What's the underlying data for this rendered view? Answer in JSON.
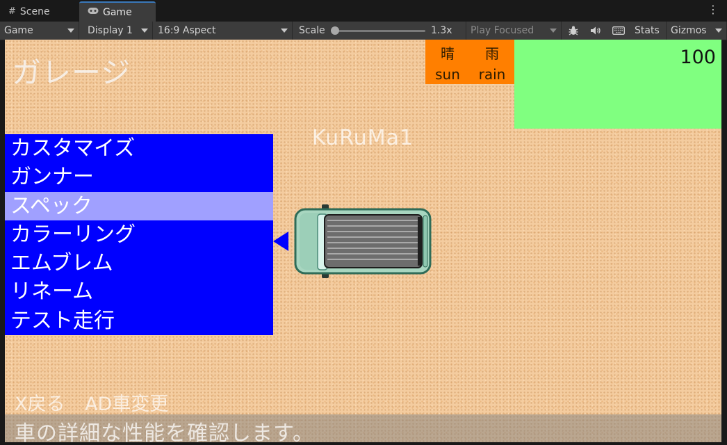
{
  "editor": {
    "tabs": [
      {
        "label": "Scene",
        "icon": "hash-icon",
        "active": false
      },
      {
        "label": "Game",
        "icon": "gamepad-icon",
        "active": true
      }
    ],
    "toolbar": {
      "view_mode": "Game",
      "display": "Display 1",
      "aspect": "16:9 Aspect",
      "scale_label": "Scale",
      "scale_value": "1.3x",
      "play_mode": "Play Focused",
      "stats_label": "Stats",
      "gizmos_label": "Gizmos"
    }
  },
  "game": {
    "title": "ガレージ",
    "weather": {
      "sun_kanji": "晴",
      "rain_kanji": "雨",
      "sun_label": "sun",
      "rain_label": "rain",
      "color": "#ff7f00"
    },
    "score": "100",
    "car_name": "KuRuMa1",
    "menu": {
      "items": [
        {
          "label": "カスタマイズ"
        },
        {
          "label": "ガンナー"
        },
        {
          "label": "スペック"
        },
        {
          "label": "カラーリング"
        },
        {
          "label": "エムブレム"
        },
        {
          "label": "リネーム"
        },
        {
          "label": "テスト走行"
        }
      ],
      "selected_index": 2,
      "background": "#0000ff",
      "highlight": "#a0a0ff"
    },
    "controls_hint": "X戻る AD車変更",
    "status_message": "車の詳細な性能を確認します。"
  }
}
